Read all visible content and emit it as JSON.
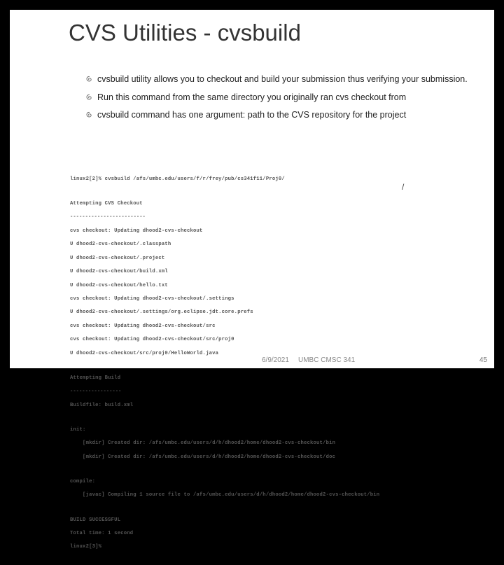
{
  "title": "CVS Utilities - cvsbuild",
  "bullets": [
    "cvsbuild utility allows you to checkout and build your submission thus verifying your submission.",
    "Run this command from the same directory you originally ran cvs checkout from",
    "cvsbuild command has one argument: path to the CVS repository for the project"
  ],
  "stray": "/",
  "terminal": {
    "prompt_cmd": "linux2[2]% cvsbuild /afs/umbc.edu/users/f/r/frey/pub/cs341f11/Proj0/",
    "attempt_checkout": "Attempting CVS Checkout",
    "dash_line": "-------------------------",
    "dash_line_short": "-----------------",
    "checkout_lines": [
      "cvs checkout: Updating dhood2-cvs-checkout",
      "U dhood2-cvs-checkout/.classpath",
      "U dhood2-cvs-checkout/.project",
      "U dhood2-cvs-checkout/build.xml",
      "U dhood2-cvs-checkout/hello.txt",
      "cvs checkout: Updating dhood2-cvs-checkout/.settings",
      "U dhood2-cvs-checkout/.settings/org.eclipse.jdt.core.prefs",
      "cvs checkout: Updating dhood2-cvs-checkout/src",
      "cvs checkout: Updating dhood2-cvs-checkout/src/proj0",
      "U dhood2-cvs-checkout/src/proj0/HelloWorld.java"
    ],
    "attempt_build": "Attempting Build",
    "buildfile": "Buildfile: build.xml",
    "init_label": "init:",
    "init_lines": [
      "    [mkdir] Created dir: /afs/umbc.edu/users/d/h/dhood2/home/dhood2-cvs-checkout/bin",
      "    [mkdir] Created dir: /afs/umbc.edu/users/d/h/dhood2/home/dhood2-cvs-checkout/doc"
    ],
    "compile_label": "compile:",
    "compile_line": "    [javac] Compiling 1 source file to /afs/umbc.edu/users/d/h/dhood2/home/dhood2-cvs-checkout/bin",
    "build_success": "BUILD SUCCESSFUL",
    "total_time": "Total time: 1 second",
    "final_prompt": "linux2[3]%"
  },
  "footer": {
    "date": "6/9/2021",
    "course": "UMBC CMSC 341",
    "page": "45"
  }
}
